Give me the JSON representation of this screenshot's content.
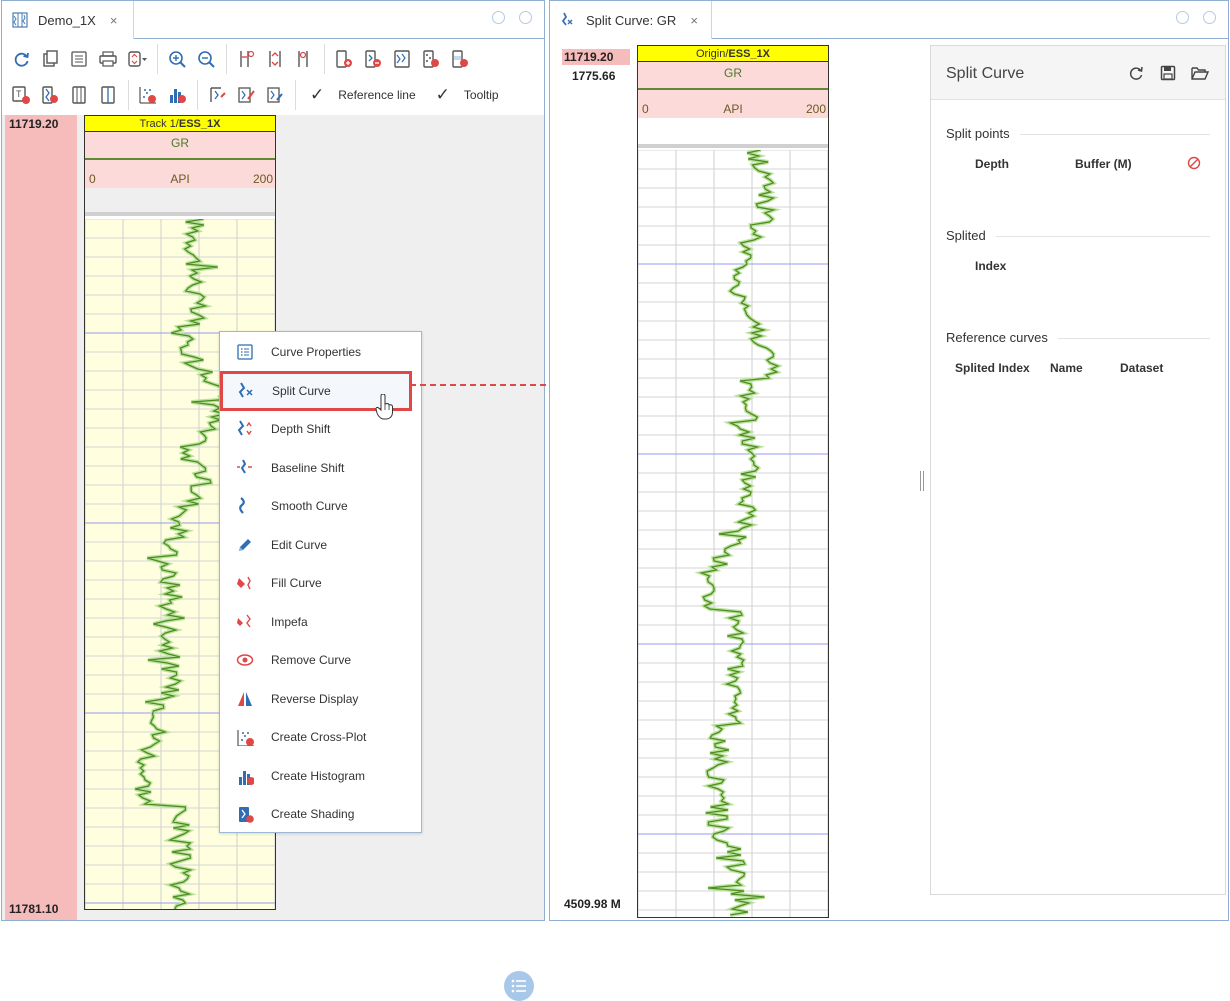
{
  "left_tab": {
    "title": "Demo_1X",
    "close": "×",
    "icon": "log-plot-icon"
  },
  "right_tab": {
    "title": "Split Curve: GR",
    "close": "×",
    "icon": "split-curve-icon"
  },
  "toolbar": {
    "row1_icons": [
      "refresh-icon",
      "copy-icon",
      "list-icon",
      "print-icon",
      "scale-dropdown-icon",
      "zoom-in-icon",
      "zoom-out-icon",
      "track-add-icon",
      "track-resize-icon",
      "track-marker-icon",
      "add-log-track-icon",
      "add-depth-track-icon",
      "add-image-track-icon",
      "add-tadpole-track-icon",
      "add-zone-track-icon"
    ],
    "row2_icons": [
      "add-text-track-icon",
      "add-curve-icon",
      "add-array-icon",
      "add-ruler-icon",
      "crossplot-icon",
      "histogram-icon",
      "curve-edit-icon",
      "curve-annotate-icon",
      "curve-tool-icon"
    ],
    "reference_line_label": "Reference line",
    "tooltip_label": "Tooltip",
    "check_mark": "✓"
  },
  "left_view": {
    "depth_top": "11719.20",
    "depth_bottom": "11781.10",
    "track_title_prefix": "Track 1/",
    "track_title_dataset": "ESS_1X",
    "curve_name": "GR",
    "curve_min": "0",
    "curve_unit": "API",
    "curve_max": "200"
  },
  "context_menu": {
    "items": [
      {
        "label": "Curve Properties",
        "icon": "properties-icon"
      },
      {
        "label": "Split Curve",
        "icon": "split-curve-icon"
      },
      {
        "label": "Depth Shift",
        "icon": "depth-shift-icon"
      },
      {
        "label": "Baseline Shift",
        "icon": "baseline-shift-icon"
      },
      {
        "label": "Smooth Curve",
        "icon": "smooth-curve-icon"
      },
      {
        "label": "Edit Curve",
        "icon": "pencil-icon"
      },
      {
        "label": "Fill Curve",
        "icon": "fill-curve-icon"
      },
      {
        "label": "Impefa",
        "icon": "impefa-icon"
      },
      {
        "label": "Remove Curve",
        "icon": "remove-eye-icon"
      },
      {
        "label": "Reverse Display",
        "icon": "reverse-icon"
      },
      {
        "label": "Create Cross-Plot",
        "icon": "crossplot-icon"
      },
      {
        "label": "Create Histogram",
        "icon": "histogram-icon"
      },
      {
        "label": "Create Shading",
        "icon": "shading-icon"
      }
    ],
    "highlighted": "Split Curve"
  },
  "right_view": {
    "depth_top": "11719.20",
    "depth_current": "1775.66",
    "depth_bottom": "4509.98 M",
    "track_title_prefix": "Origin/",
    "track_title_dataset": "ESS_1X",
    "curve_name": "GR",
    "curve_min": "0",
    "curve_unit": "API",
    "curve_max": "200"
  },
  "split_panel": {
    "title": "Split Curve",
    "buttons": [
      "refresh-icon",
      "save-icon",
      "open-folder-icon"
    ],
    "split_points": {
      "title": "Split points",
      "col_depth": "Depth",
      "col_buffer": "Buffer (M)"
    },
    "splited": {
      "title": "Splited",
      "col_index": "Index"
    },
    "reference_curves": {
      "title": "Reference curves",
      "col_splited_index": "Splited Index",
      "col_name": "Name",
      "col_dataset": "Dataset"
    }
  },
  "colors": {
    "border_blue": "#8fb0d2",
    "depth_pink": "#f6bcbc",
    "track_yellow": "#ffff00",
    "curve_green": "#5d8a33",
    "highlight_red": "#e04848",
    "plot_bg": "#ffffe0"
  }
}
